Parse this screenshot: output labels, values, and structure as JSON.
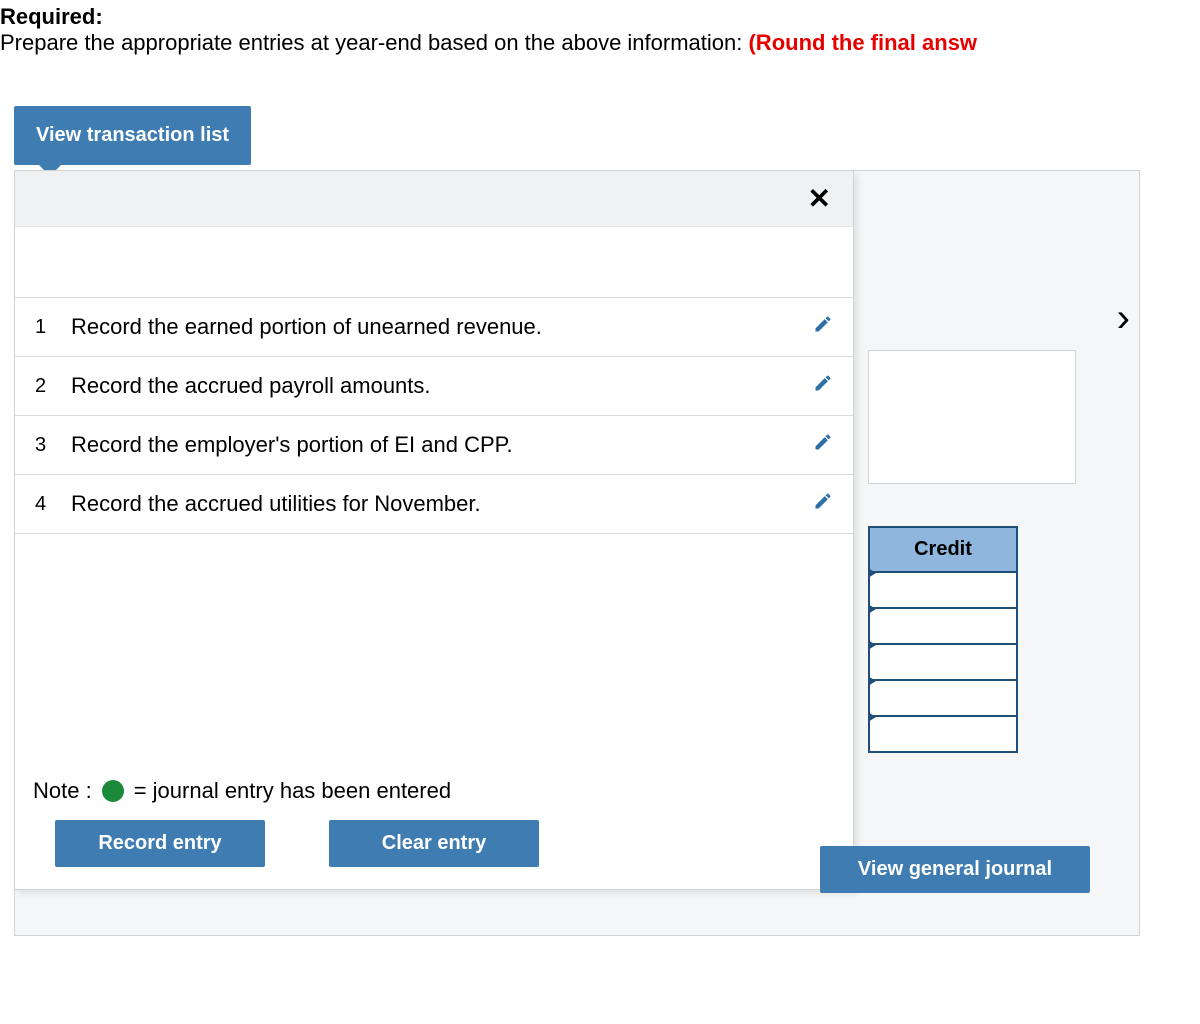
{
  "prompt": {
    "required_label": "Required:",
    "text": "Prepare the appropriate entries at year-end based on the above information: ",
    "emphasis": "(Round the final answ"
  },
  "tab": {
    "label": "View transaction list"
  },
  "close": {
    "glyph": "✕"
  },
  "transactions": [
    {
      "num": "1",
      "desc": "Record the earned portion of unearned revenue."
    },
    {
      "num": "2",
      "desc": "Record the accrued payroll amounts."
    },
    {
      "num": "3",
      "desc": "Record the employer's portion of EI and CPP."
    },
    {
      "num": "4",
      "desc": "Record the accrued utilities for November."
    }
  ],
  "note": {
    "label": "Note :",
    "text": "= journal entry has been entered"
  },
  "buttons": {
    "record": "Record entry",
    "clear": "Clear entry",
    "view_journal": "View general journal"
  },
  "nav": {
    "next": "›"
  },
  "credit": {
    "header": "Credit",
    "rows": 5
  }
}
